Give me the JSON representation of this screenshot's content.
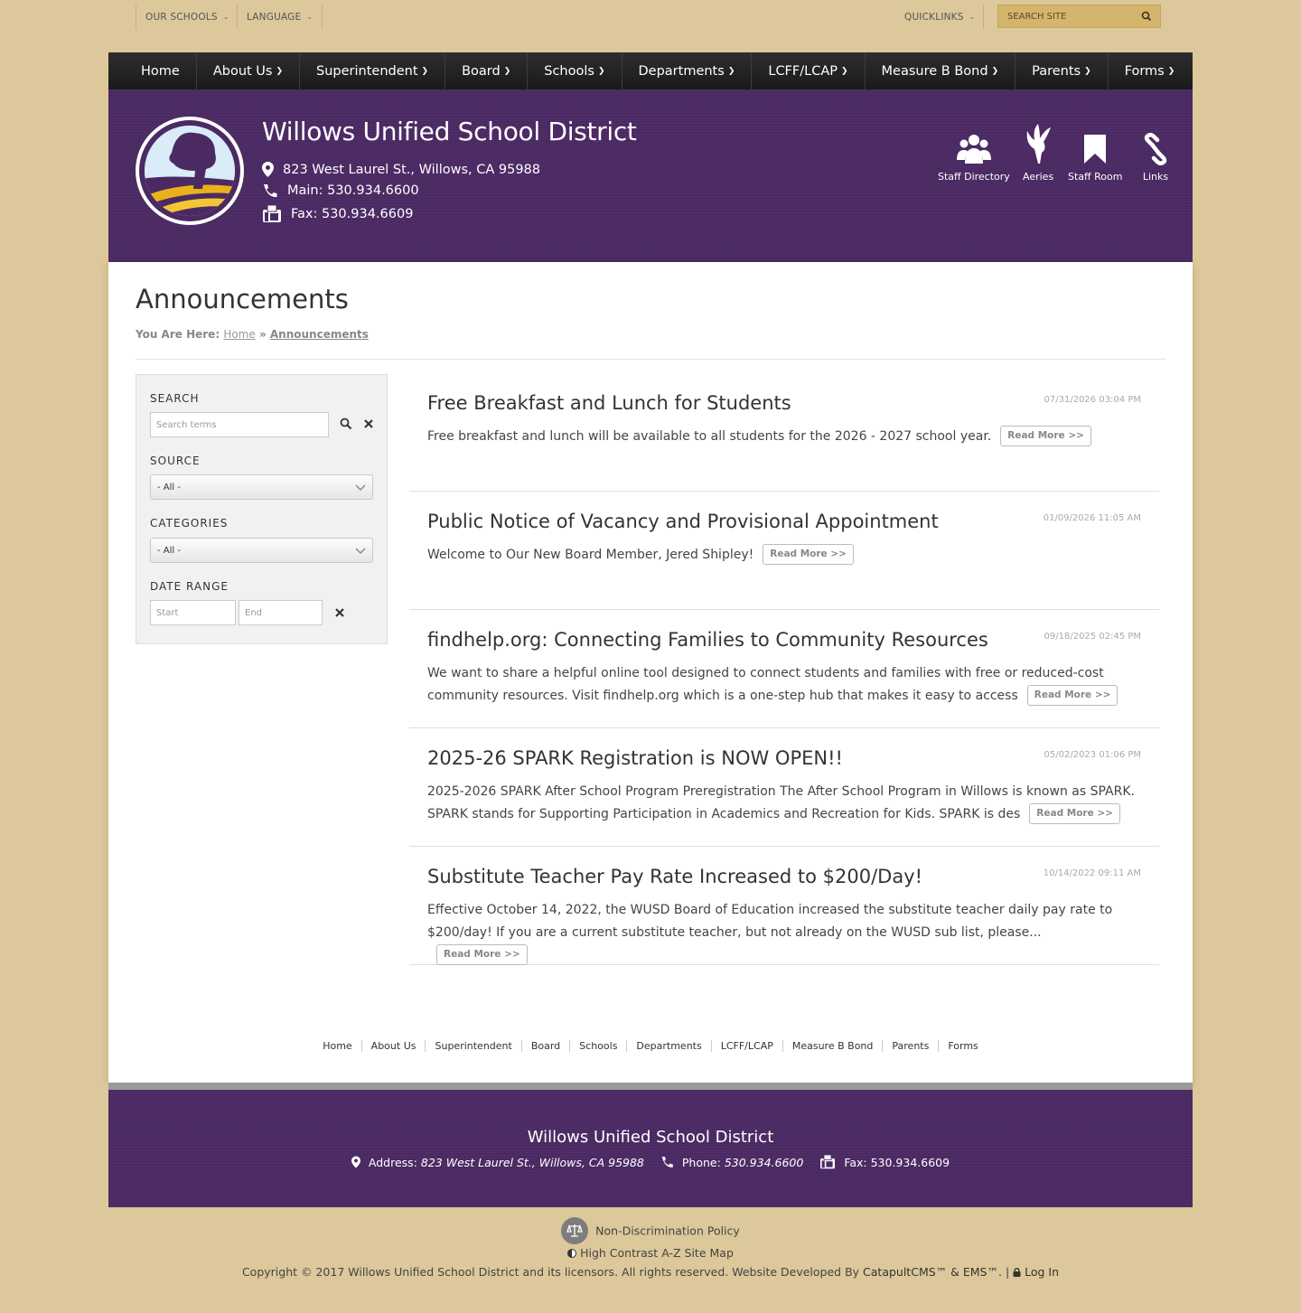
{
  "utility": {
    "our_schools": "OUR SCHOOLS",
    "language": "LANGUAGE",
    "quicklinks": "QUICKLINKS",
    "search_placeholder": "SEARCH SITE"
  },
  "nav": [
    "Home",
    "About Us",
    "Superintendent",
    "Board",
    "Schools",
    "Departments",
    "LCFF/LCAP",
    "Measure B Bond",
    "Parents",
    "Forms"
  ],
  "header": {
    "title": "Willows Unified School District",
    "address": "823 West Laurel St., Willows, CA 95988",
    "main_phone": "Main: 530.934.6600",
    "fax": "Fax: 530.934.6609",
    "quick_links": [
      "Staff Directory",
      "Aeries",
      "Staff Room",
      "Links"
    ]
  },
  "page": {
    "title": "Announcements",
    "breadcrumb_prefix": "You Are Here:",
    "breadcrumb_home": "Home",
    "breadcrumb_sep": "»",
    "breadcrumb_current": "Announcements"
  },
  "sidebar": {
    "search_label": "SEARCH",
    "search_placeholder": "Search terms",
    "source_label": "SOURCE",
    "source_value": "- All -",
    "categories_label": "CATEGORIES",
    "categories_value": "- All -",
    "date_label": "DATE RANGE",
    "start_placeholder": "Start",
    "end_placeholder": "End"
  },
  "read_more": "Read More >>",
  "announcements": [
    {
      "title": "Free Breakfast and Lunch for Students",
      "date": "07/31/2026 03:04 PM",
      "body": "Free breakfast and lunch will be available to all students for the 2026 - 2027 school year."
    },
    {
      "title": "Public Notice of Vacancy and Provisional Appointment",
      "date": "01/09/2026 11:05 AM",
      "body": "Welcome to Our New Board Member, Jered Shipley!"
    },
    {
      "title": "findhelp.org: Connecting Families to Community Resources",
      "date": "09/18/2025 02:45 PM",
      "body": "We want to share a helpful online tool designed to connect students and families with free or reduced-cost community resources. Visit findhelp.org which is a one-step hub that makes it easy to access"
    },
    {
      "title": "2025-26 SPARK Registration is NOW OPEN!!",
      "date": "05/02/2023 01:06 PM",
      "body": "2025-2026 SPARK After School Program Preregistration The After School Program in Willows is known as SPARK. SPARK stands for Supporting Participation in Academics and Recreation for Kids. SPARK is des"
    },
    {
      "title": "Substitute Teacher Pay Rate Increased to $200/Day!",
      "date": "10/14/2022 09:11 AM",
      "body": "Effective October 14, 2022, the WUSD Board of Education increased the substitute teacher daily pay rate to $200/day! If you are a current substitute teacher, but not already on the WUSD sub list, please..."
    }
  ],
  "footer_links": [
    "Home",
    "About Us",
    "Superintendent",
    "Board",
    "Schools",
    "Departments",
    "LCFF/LCAP",
    "Measure B Bond",
    "Parents",
    "Forms"
  ],
  "footer": {
    "title": "Willows Unified School District",
    "address_label": "Address:",
    "address": "823 West Laurel St., Willows, CA 95988",
    "phone_label": "Phone:",
    "phone": "530.934.6600",
    "fax": "Fax: 530.934.6609"
  },
  "bottom": {
    "non_discrimination": "Non-Discrimination Policy",
    "high_contrast": "High Contrast",
    "site_map": "A-Z Site Map",
    "copyright": "Copyright © 2017 Willows Unified School District and its licensors. All rights reserved. Website Developed By",
    "developer": "CatapultCMS™ & EMS™.",
    "login": "Log In"
  },
  "colors": {
    "page_bg": "#dcc89a",
    "brand_purple": "#4b2a63",
    "nav_bg": "#1f1f1f",
    "logo_gold": "#e9b21c"
  }
}
